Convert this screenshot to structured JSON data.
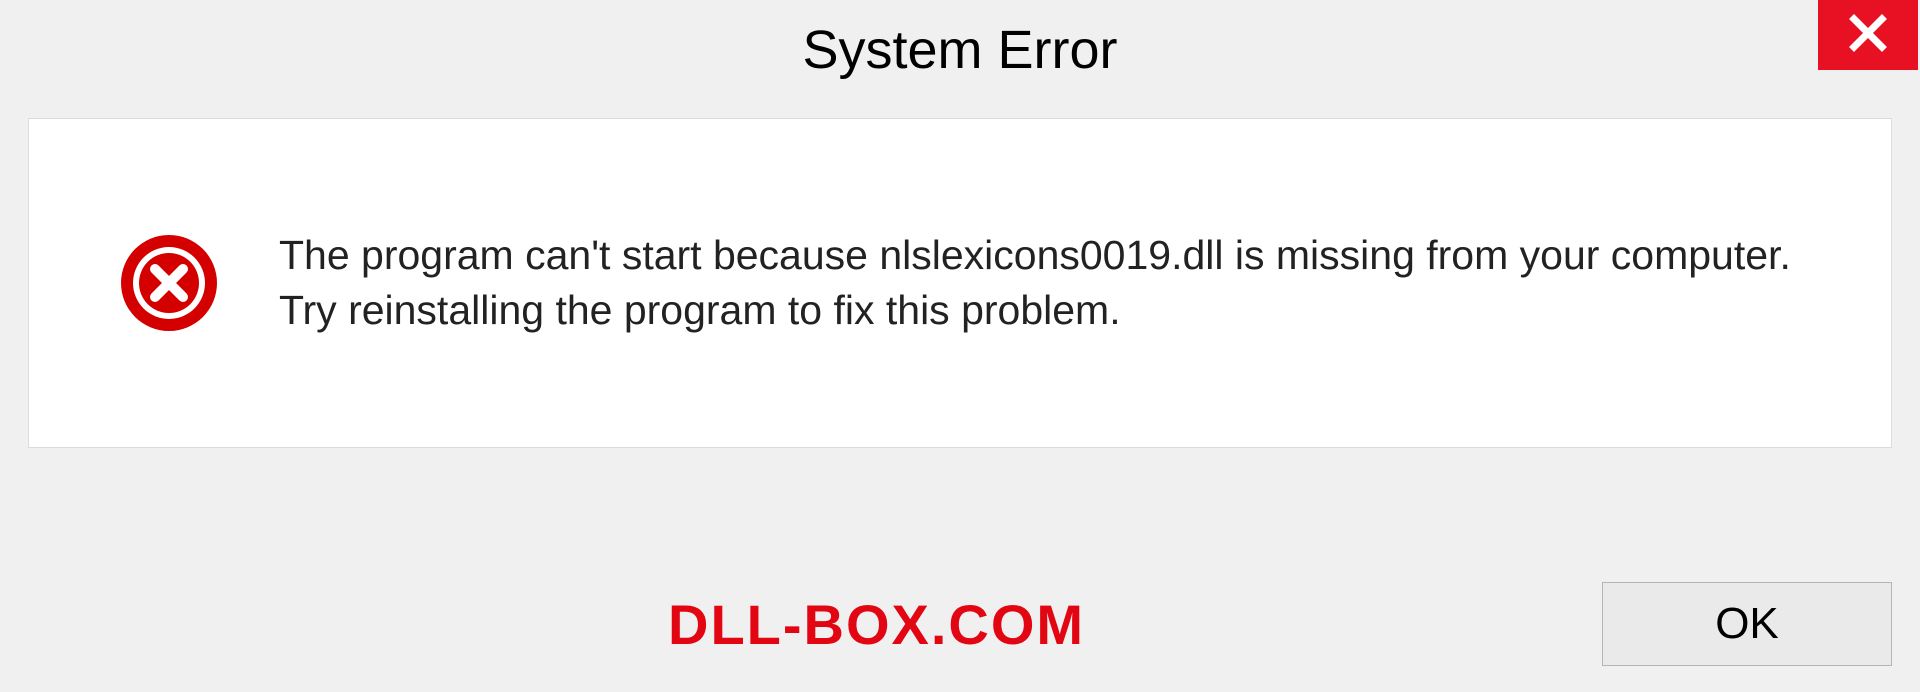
{
  "titlebar": {
    "title": "System Error"
  },
  "message": {
    "text": "The program can't start because nlslexicons0019.dll is missing from your computer. Try reinstalling the program to fix this problem."
  },
  "footer": {
    "watermark": "DLL-BOX.COM",
    "ok_label": "OK"
  },
  "colors": {
    "close_bg": "#e81123",
    "error_icon": "#d40000",
    "watermark": "#e20613"
  }
}
